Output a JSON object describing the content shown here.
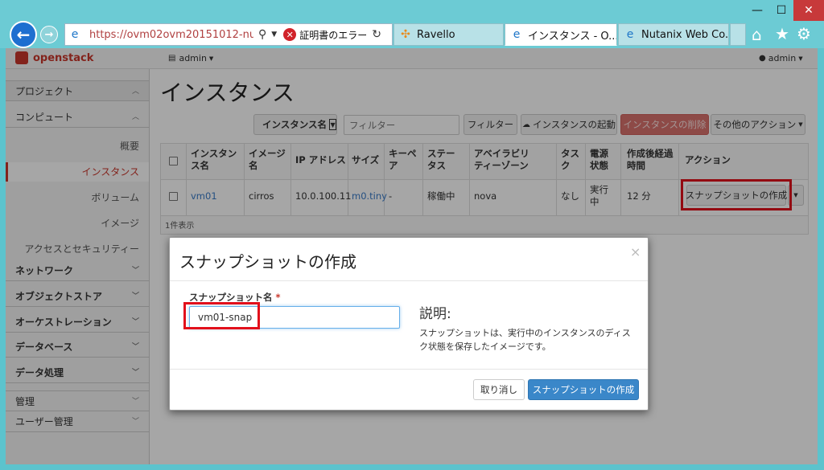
{
  "browser": {
    "url": "https://ovm02ovm20151012-nut...",
    "cert_error": "証明書のエラー",
    "tabs": [
      "Ravello",
      "インスタンス - O...",
      "Nutanix Web Co..."
    ],
    "window_controls": {
      "minimize": "—",
      "maximize": "☐",
      "close": "✕"
    }
  },
  "topbar": {
    "logo": "openstack",
    "project": "admin",
    "user": "admin"
  },
  "sidebar": {
    "project_header": "プロジェクト",
    "compute": "コンピュート",
    "compute_items": [
      "概要",
      "インスタンス",
      "ボリューム",
      "イメージ",
      "アクセスとセキュリティー"
    ],
    "sections": [
      "ネットワーク",
      "オブジェクトストア",
      "オーケストレーション",
      "データベース",
      "データ処理"
    ],
    "admin": "管理",
    "identity": "ユーザー管理"
  },
  "main": {
    "title": "インスタンス",
    "filter_select": "インスタンス名",
    "filter_placeholder": "フィルター",
    "filter_button": "フィルター",
    "launch_button": "インスタンスの起動",
    "delete_button": "インスタンスの削除",
    "more_button": "その他のアクション",
    "table": {
      "headers": [
        "インスタン\nス名",
        "イメージ\n名",
        "IP アドレス",
        "サイズ",
        "キーペ\nア",
        "ステー\nタス",
        "アベイラビリ\nティーゾーン",
        "タス\nク",
        "電源\n状態",
        "作成後経過\n時間",
        "アクション"
      ],
      "row": [
        "vm01",
        "cirros",
        "10.0.100.11",
        "m0.tiny",
        "-",
        "稼働中",
        "nova",
        "なし",
        "実行\n中",
        "12 分"
      ],
      "row_action": "スナップショットの作成",
      "footer": "1件表示"
    }
  },
  "modal": {
    "title": "スナップショットの作成",
    "close": "×",
    "field_label": "スナップショット名",
    "required_mark": "*",
    "field_value": "vm01-snap",
    "desc_title": "説明:",
    "desc_text": "スナップショットは、実行中のインスタンスのディスク状態を保存したイメージです。",
    "cancel": "取り消し",
    "submit": "スナップショットの作成"
  },
  "colors": {
    "chrome_bg": "#6ccbd4",
    "primary_button": "#3a87c9",
    "danger_button": "#d9726e",
    "highlight": "#e2101b",
    "link": "#3a7bc8"
  }
}
